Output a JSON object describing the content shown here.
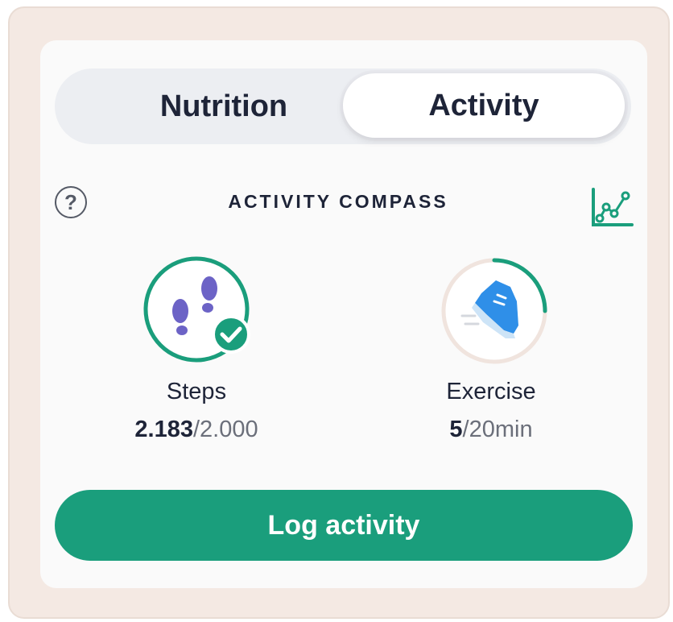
{
  "tabs": {
    "nutrition": "Nutrition",
    "activity": "Activity",
    "active": "Activity"
  },
  "compass": {
    "title": "ACTIVITY COMPASS",
    "help_glyph": "?",
    "help_icon": "question-circle-icon",
    "chart_icon": "line-chart-icon"
  },
  "steps": {
    "label": "Steps",
    "current": "2.183",
    "goal": "/2.000",
    "icon": "footprints-icon",
    "completed": true,
    "progress": 1.0
  },
  "exercise": {
    "label": "Exercise",
    "current": "5",
    "goal": "/20min",
    "icon": "sneaker-icon",
    "progress": 0.25
  },
  "actions": {
    "log_activity": "Log activity"
  },
  "colors": {
    "accent": "#1a9e7c",
    "text": "#1e2438",
    "footprints": "#6c63c6",
    "sneaker": "#2f8fe8",
    "frame": "#f4e9e3"
  }
}
